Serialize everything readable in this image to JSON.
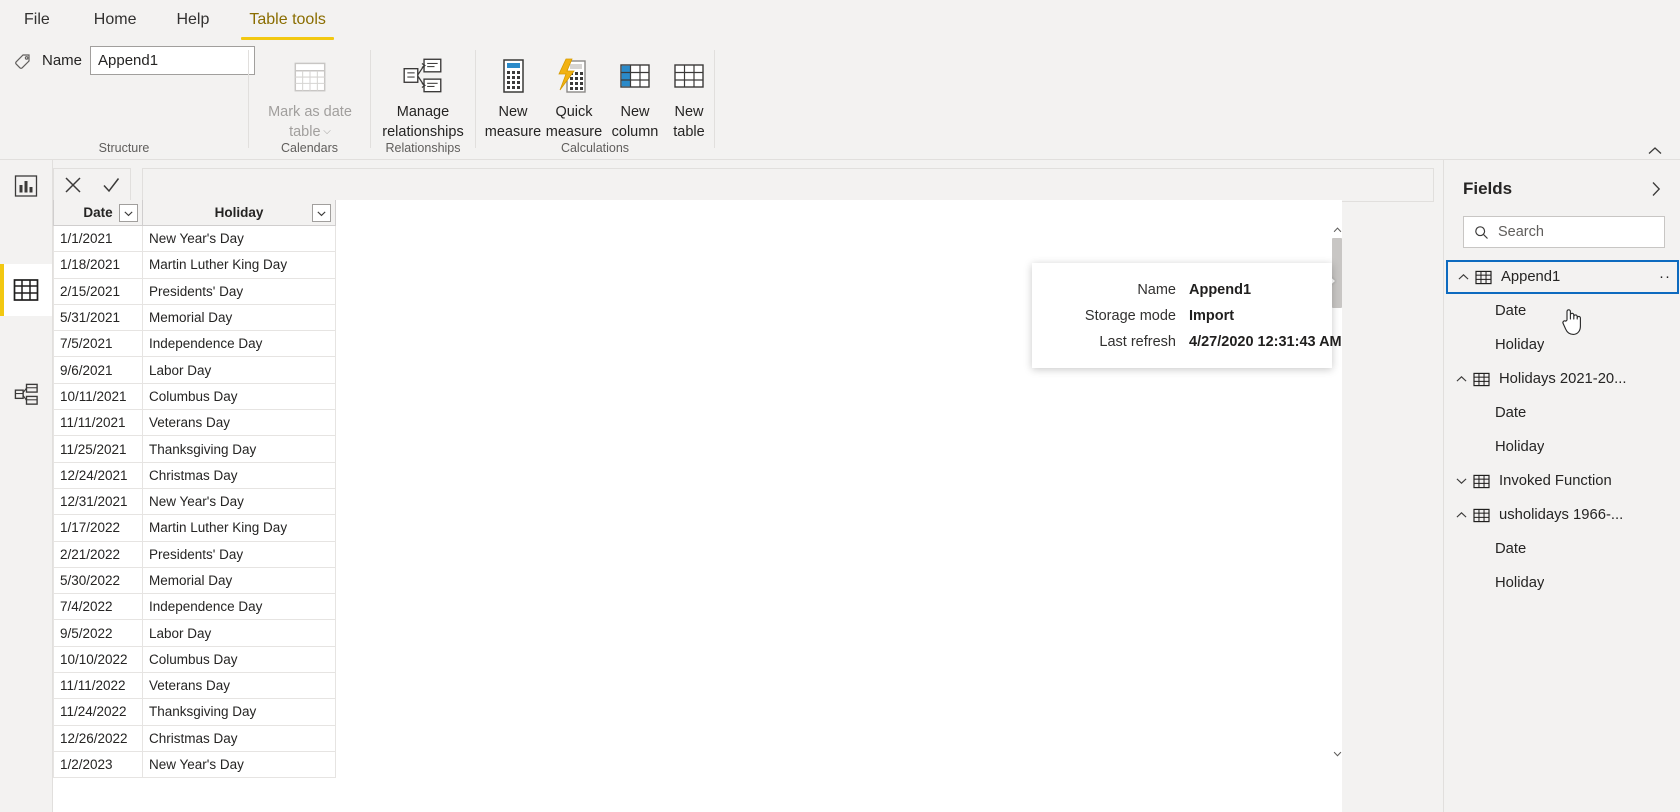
{
  "ribbon": {
    "tabs": [
      {
        "label": "File",
        "active": false
      },
      {
        "label": "Home",
        "active": false
      },
      {
        "label": "Help",
        "active": false
      },
      {
        "label": "Table tools",
        "active": true
      }
    ],
    "groups": [
      {
        "caption": "Structure"
      },
      {
        "caption": "Calendars"
      },
      {
        "caption": "Relationships"
      },
      {
        "caption": "Calculations"
      }
    ],
    "name_label": "Name",
    "name_value": "Append1",
    "buttons": [
      {
        "id": "mark-as-date-table",
        "label": "Mark as date\ntable",
        "icon": "calendar-icon",
        "disabled": true,
        "has_chevron": true
      },
      {
        "id": "manage-relationships",
        "label": "Manage\nrelationships",
        "icon": "relationships-icon",
        "disabled": false,
        "has_chevron": false
      },
      {
        "id": "new-measure",
        "label": "New\nmeasure",
        "icon": "new-measure-icon",
        "disabled": false,
        "has_chevron": false
      },
      {
        "id": "quick-measure",
        "label": "Quick\nmeasure",
        "icon": "quick-measure-icon",
        "disabled": false,
        "has_chevron": false
      },
      {
        "id": "new-column",
        "label": "New\ncolumn",
        "icon": "new-column-icon",
        "disabled": false,
        "has_chevron": false
      },
      {
        "id": "new-table",
        "label": "New\ntable",
        "icon": "new-table-icon",
        "disabled": false,
        "has_chevron": false
      }
    ],
    "collapse_icon": "chevron-up-icon"
  },
  "leftnav": {
    "items": [
      {
        "id": "report-view",
        "icon": "chart-report-icon",
        "active": false
      },
      {
        "id": "data-view",
        "icon": "table-data-icon",
        "active": true
      },
      {
        "id": "model-view",
        "icon": "model-relationships-icon",
        "active": false
      }
    ]
  },
  "formula_bar": {
    "cancel_icon": "close-x-icon",
    "accept_icon": "checkmark-icon",
    "value": "",
    "placeholder": ""
  },
  "grid": {
    "columns": [
      {
        "key": "date",
        "label": "Date"
      },
      {
        "key": "holiday",
        "label": "Holiday"
      }
    ],
    "rows": [
      {
        "date": "1/1/2021",
        "holiday": "New Year's Day"
      },
      {
        "date": "1/18/2021",
        "holiday": "Martin Luther King Day"
      },
      {
        "date": "2/15/2021",
        "holiday": "Presidents' Day"
      },
      {
        "date": "5/31/2021",
        "holiday": "Memorial Day"
      },
      {
        "date": "7/5/2021",
        "holiday": "Independence Day"
      },
      {
        "date": "9/6/2021",
        "holiday": "Labor Day"
      },
      {
        "date": "10/11/2021",
        "holiday": "Columbus Day"
      },
      {
        "date": "11/11/2021",
        "holiday": "Veterans Day"
      },
      {
        "date": "11/25/2021",
        "holiday": "Thanksgiving Day"
      },
      {
        "date": "12/24/2021",
        "holiday": "Christmas Day"
      },
      {
        "date": "12/31/2021",
        "holiday": "New Year's Day"
      },
      {
        "date": "1/17/2022",
        "holiday": "Martin Luther King Day"
      },
      {
        "date": "2/21/2022",
        "holiday": "Presidents' Day"
      },
      {
        "date": "5/30/2022",
        "holiday": "Memorial Day"
      },
      {
        "date": "7/4/2022",
        "holiday": "Independence Day"
      },
      {
        "date": "9/5/2022",
        "holiday": "Labor Day"
      },
      {
        "date": "10/10/2022",
        "holiday": "Columbus Day"
      },
      {
        "date": "11/11/2022",
        "holiday": "Veterans Day"
      },
      {
        "date": "11/24/2022",
        "holiday": "Thanksgiving Day"
      },
      {
        "date": "12/26/2022",
        "holiday": "Christmas Day"
      },
      {
        "date": "1/2/2023",
        "holiday": "New Year's Day"
      }
    ],
    "scroll_up_icon": "chevron-up-icon",
    "scroll_down_icon": "chevron-down-icon"
  },
  "tooltip": {
    "rows": [
      {
        "key": "Name",
        "value": "Append1"
      },
      {
        "key": "Storage mode",
        "value": "Import"
      },
      {
        "key": "Last refresh",
        "value": "4/27/2020 12:31:43 AM"
      }
    ]
  },
  "fields": {
    "title": "Fields",
    "expand_icon": "chevron-right-icon",
    "search_placeholder": "Search",
    "search_value": "",
    "search_icon": "search-icon",
    "more_label": "··",
    "nodes": [
      {
        "label": "Append1",
        "type": "table",
        "expanded": true,
        "selected": true,
        "icon": "table-icon"
      },
      {
        "label": "Date",
        "type": "leaf",
        "icon": "field-icon"
      },
      {
        "label": "Holiday",
        "type": "leaf",
        "icon": "field-icon"
      },
      {
        "label": "Holidays 2021-20...",
        "type": "table",
        "expanded": true,
        "selected": false,
        "icon": "table-icon"
      },
      {
        "label": "Date",
        "type": "leaf",
        "icon": "field-icon"
      },
      {
        "label": "Holiday",
        "type": "leaf",
        "icon": "field-icon"
      },
      {
        "label": "Invoked Function",
        "type": "table",
        "expanded": false,
        "selected": false,
        "icon": "table-icon"
      },
      {
        "label": "usholidays 1966-...",
        "type": "table",
        "expanded": true,
        "selected": false,
        "icon": "table-icon"
      },
      {
        "label": "Date",
        "type": "leaf",
        "icon": "field-icon"
      },
      {
        "label": "Holiday",
        "type": "leaf",
        "icon": "field-icon"
      }
    ]
  },
  "colors": {
    "accent_yellow": "#f2c811",
    "selection_blue": "#0d6abf",
    "chrome_gray": "#f3f2f1",
    "active_tab_text": "#8a6d00"
  },
  "cursor": {
    "icon": "hand-pointer-cursor"
  }
}
